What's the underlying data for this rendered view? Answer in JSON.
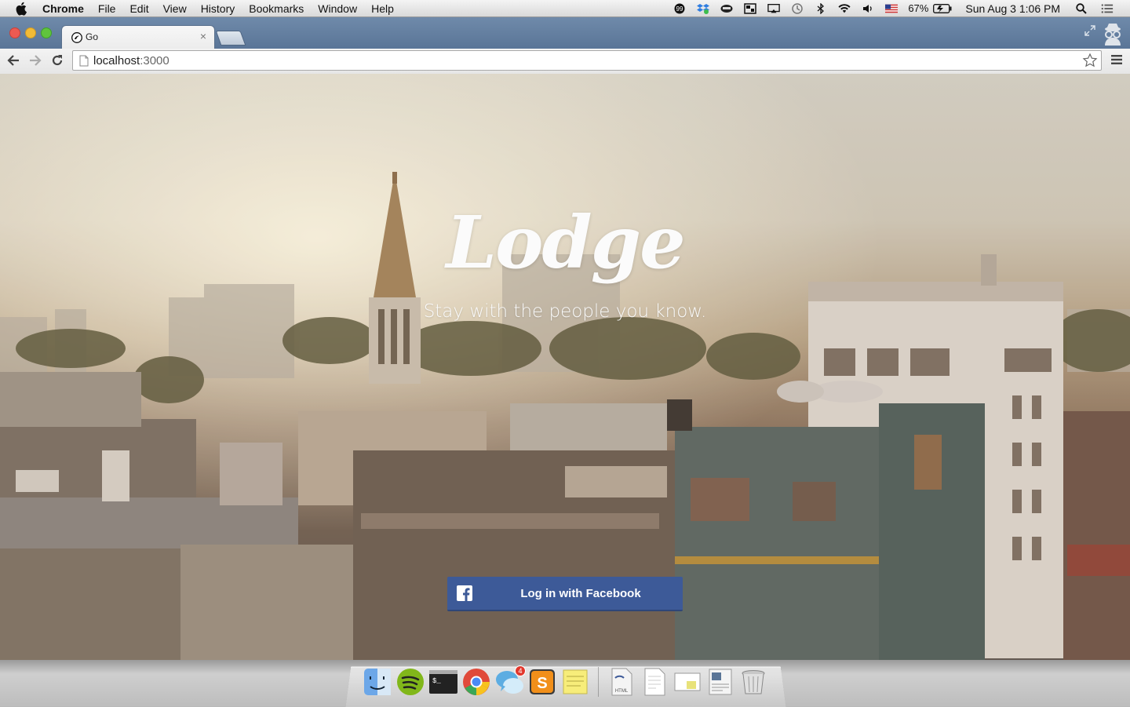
{
  "menubar": {
    "app": "Chrome",
    "menus": [
      "File",
      "Edit",
      "View",
      "History",
      "Bookmarks",
      "Window",
      "Help"
    ],
    "battery": "67%",
    "clock": "Sun Aug 3  1:06 PM"
  },
  "browser": {
    "tab_title": "Go",
    "tab_close": "×",
    "url_host": "localhost",
    "url_port": ":3000"
  },
  "page": {
    "logo": "Lodge",
    "tagline": "Stay with the people you know.",
    "login_button": "Log in with Facebook"
  },
  "dock": {
    "items": [
      "finder-icon",
      "spotify-icon",
      "terminal-icon",
      "chrome-icon",
      "messages-icon",
      "sublime-text-icon",
      "stickies-icon",
      "html-file-icon",
      "document-icon",
      "preview-icon",
      "screenshot-icon",
      "trash-icon"
    ],
    "messages_badge": "4"
  },
  "colors": {
    "facebook_blue": "#3d5a98",
    "chrome_frame": "#5f7a9c"
  }
}
